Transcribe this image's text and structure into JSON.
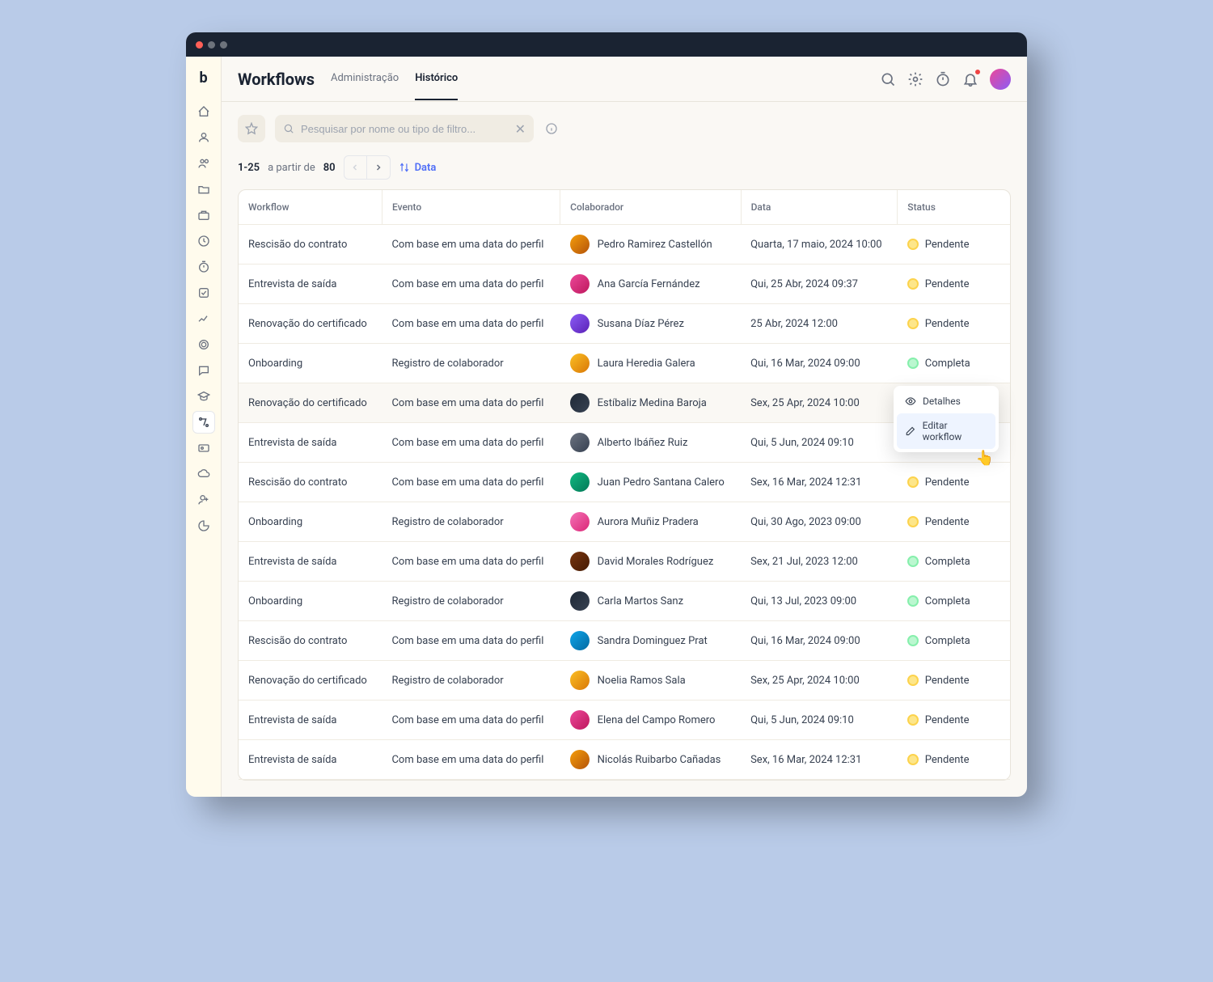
{
  "header": {
    "title": "Workflows",
    "tabs": [
      "Administração",
      "Histórico"
    ],
    "active_tab": 1
  },
  "search": {
    "placeholder": "Pesquisar por nome ou tipo de filtro..."
  },
  "pagination": {
    "range": "1-25",
    "separator": "a partir de",
    "total": "80",
    "sort_label": "Data"
  },
  "columns": [
    "Workflow",
    "Evento",
    "Colaborador",
    "Data",
    "Status"
  ],
  "status_labels": {
    "pending": "Pendente",
    "complete": "Completa"
  },
  "context_menu": {
    "details": "Detalhes",
    "edit": "Editar workflow"
  },
  "rows": [
    {
      "workflow": "Rescisão do contrato",
      "evento": "Com base em uma data do perfil",
      "colaborador": "Pedro Ramirez Castellón",
      "data": "Quarta, 17 maio, 2024 10:00",
      "status": "pending",
      "av": "av1"
    },
    {
      "workflow": "Entrevista de saída",
      "evento": "Com base em uma data do perfil",
      "colaborador": "Ana García Fernández",
      "data": "Qui, 25 Abr, 2024 09:37",
      "status": "pending",
      "av": "av2"
    },
    {
      "workflow": "Renovação do certificado",
      "evento": "Com base em uma data do perfil",
      "colaborador": "Susana Díaz Pérez",
      "data": "25 Abr, 2024 12:00",
      "status": "pending",
      "av": "av3"
    },
    {
      "workflow": "Onboarding",
      "evento": "Registro de colaborador",
      "colaborador": "Laura Heredia Galera",
      "data": "Qui, 16 Mar, 2024 09:00",
      "status": "complete",
      "av": "av4"
    },
    {
      "workflow": "Renovação do certificado",
      "evento": "Com base em uma data do perfil",
      "colaborador": "Estíbaliz Medina Baroja",
      "data": "Sex, 25 Apr, 2024 10:00",
      "status": "complete",
      "av": "av5",
      "hover": true
    },
    {
      "workflow": "Entrevista de saída",
      "evento": "Com base em uma data do perfil",
      "colaborador": "Alberto Ibáñez Ruiz",
      "data": "Qui, 5 Jun, 2024 09:10",
      "status": "pending",
      "av": "av6"
    },
    {
      "workflow": "Rescisão do contrato",
      "evento": "Com base em uma data do perfil",
      "colaborador": "Juan Pedro Santana Calero",
      "data": "Sex, 16 Mar, 2024 12:31",
      "status": "pending",
      "av": "av7"
    },
    {
      "workflow": "Onboarding",
      "evento": "Registro de colaborador",
      "colaborador": "Aurora Muñiz Pradera",
      "data": "Qui, 30 Ago, 2023 09:00",
      "status": "pending",
      "av": "av8"
    },
    {
      "workflow": "Entrevista de saída",
      "evento": "Com base em uma data do perfil",
      "colaborador": "David Morales Rodríguez",
      "data": "Sex, 21 Jul, 2023 12:00",
      "status": "complete",
      "av": "av9"
    },
    {
      "workflow": "Onboarding",
      "evento": "Registro de colaborador",
      "colaborador": "Carla Martos Sanz",
      "data": "Qui, 13 Jul, 2023 09:00",
      "status": "complete",
      "av": "av5"
    },
    {
      "workflow": "Rescisão do contrato",
      "evento": "Com base em uma data do perfil",
      "colaborador": "Sandra Dominguez Prat",
      "data": "Qui, 16 Mar, 2024 09:00",
      "status": "complete",
      "av": "av10"
    },
    {
      "workflow": "Renovação do certificado",
      "evento": "Registro de colaborador",
      "colaborador": "Noelia Ramos Sala",
      "data": "Sex, 25 Apr, 2024 10:00",
      "status": "pending",
      "av": "av4"
    },
    {
      "workflow": "Entrevista de saída",
      "evento": "Com base em uma data do perfil",
      "colaborador": "Elena del Campo Romero",
      "data": "Qui, 5 Jun, 2024 09:10",
      "status": "pending",
      "av": "av2"
    },
    {
      "workflow": "Entrevista de saída",
      "evento": "Com base em uma data do perfil",
      "colaborador": "Nicolás Ruibarbo Cañadas",
      "data": "Sex, 16 Mar, 2024 12:31",
      "status": "pending",
      "av": "av1"
    }
  ]
}
